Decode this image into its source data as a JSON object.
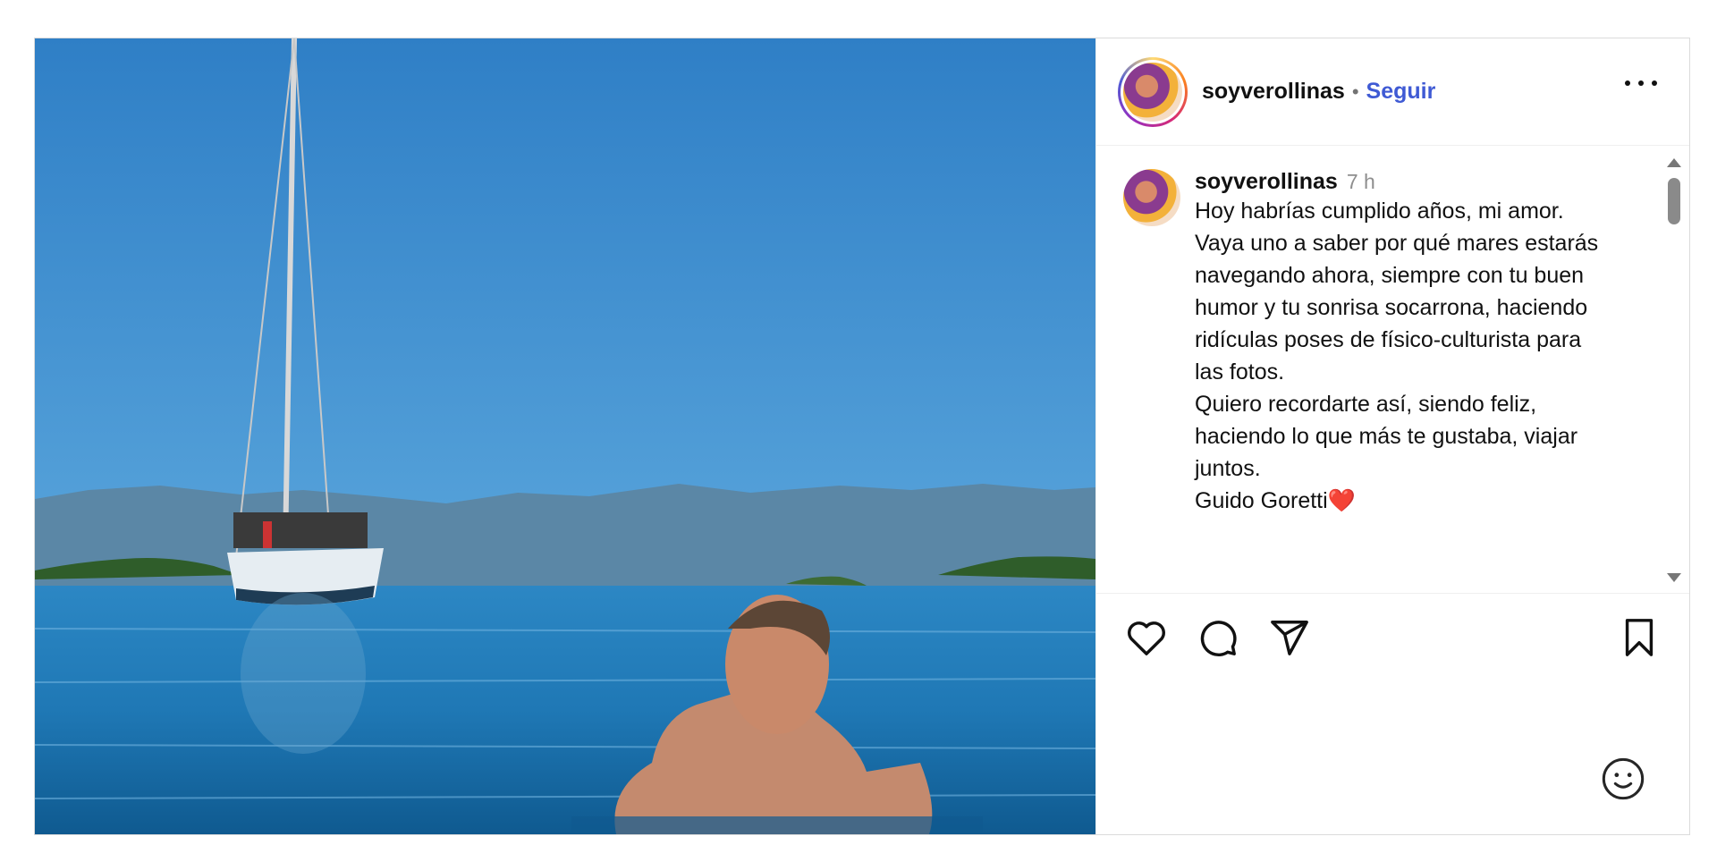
{
  "post": {
    "username": "soyverollinas",
    "separator": "•",
    "follow_label": "Seguir",
    "more_icon": "more-horizontal-icon",
    "caption": {
      "username": "soyverollinas",
      "time": "7 h",
      "lines": [
        "Hoy habrías cumplido años, mi amor.",
        "Vaya uno a saber por qué mares estarás",
        "navegando ahora, siempre con tu buen",
        "humor y tu sonrisa socarrona, haciendo",
        "ridículas poses de físico-culturista para",
        "las fotos.",
        "Quiero recordarte así, siendo feliz,",
        "haciendo lo que más te gustaba, viajar",
        "juntos.",
        "Guido Goretti"
      ],
      "emoji": "❤️"
    },
    "actions": {
      "like_icon": "heart-icon",
      "comment_icon": "comment-icon",
      "share_icon": "send-icon",
      "save_icon": "bookmark-icon",
      "emoji_icon": "smiley-icon"
    },
    "colors": {
      "follow": "#3f5ad4",
      "meta": "#8e8e8e",
      "border": "#dbdbdb"
    }
  }
}
